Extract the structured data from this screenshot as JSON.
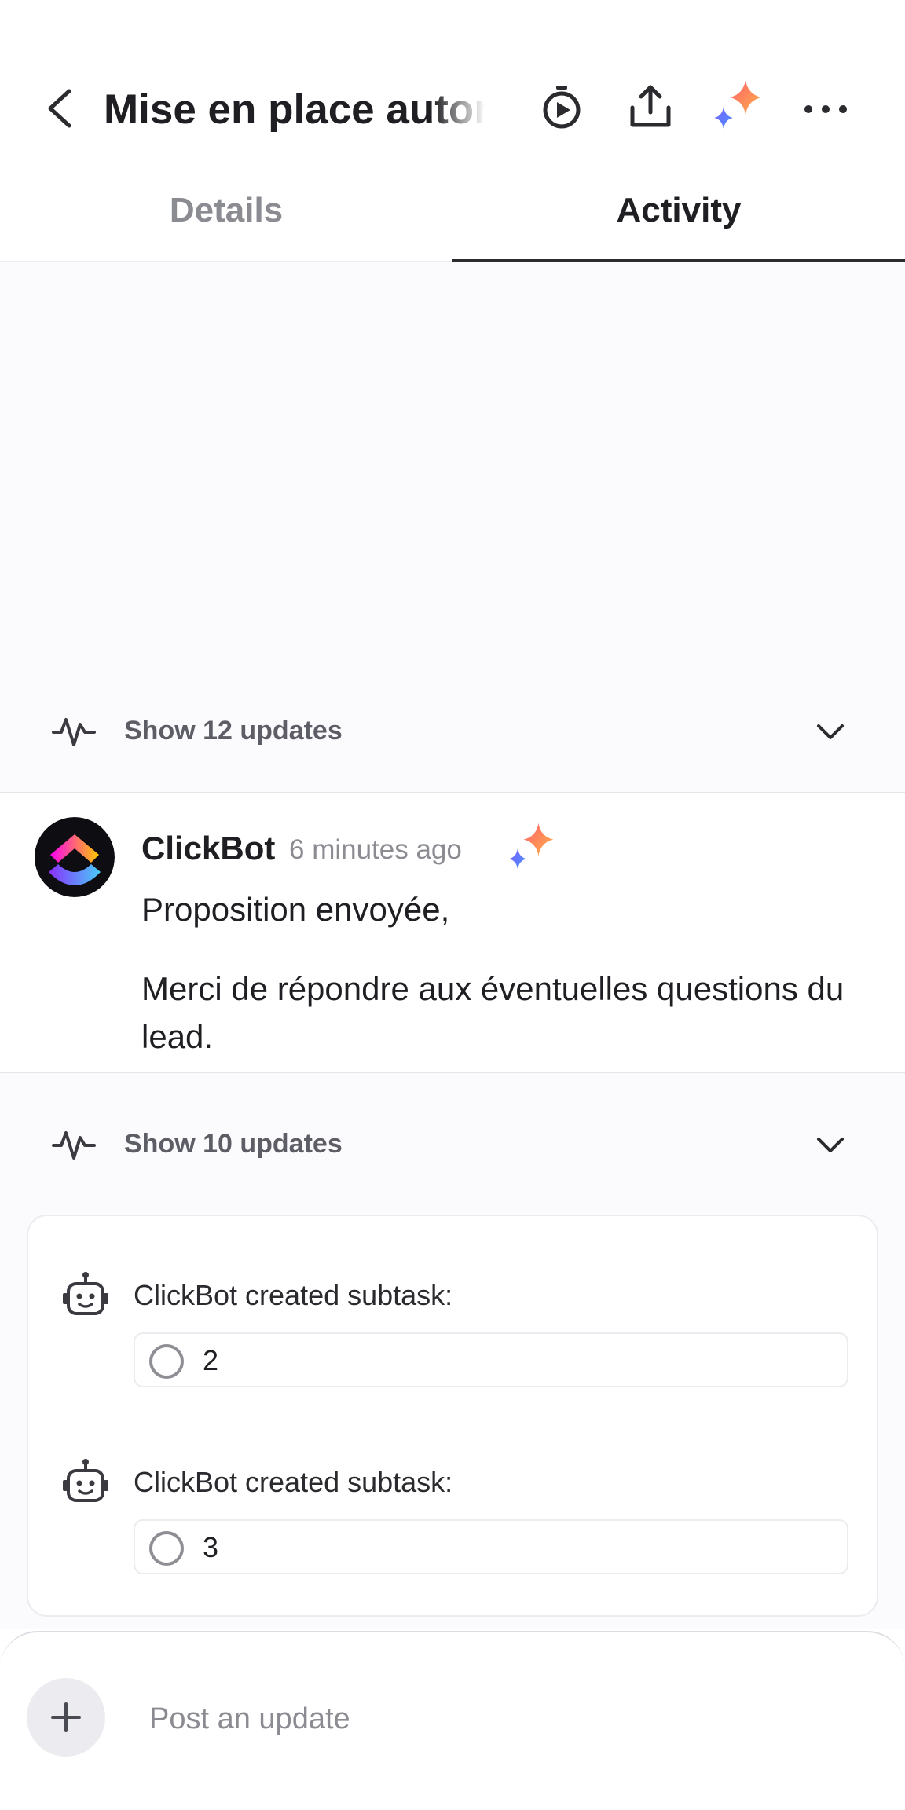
{
  "header": {
    "title": "Mise en place autom",
    "icons": [
      "back-arrow-icon",
      "timer-icon",
      "share-icon",
      "ai-sparkle-icon",
      "more-icon"
    ]
  },
  "tabs": [
    {
      "label": "Details",
      "active": false
    },
    {
      "label": "Activity",
      "active": true
    }
  ],
  "feed": {
    "updates_group_1": {
      "label": "Show 12 updates"
    },
    "comment": {
      "author": "ClickBot",
      "time": "6 minutes ago",
      "lines": [
        "Proposition envoyée,",
        "Merci de répondre aux éventuelles questions du lead."
      ]
    },
    "updates_group_2": {
      "label": "Show 10 updates"
    },
    "subtasks": [
      {
        "label": "ClickBot created subtask:",
        "name": "2"
      },
      {
        "label": "ClickBot created subtask:",
        "name": "3"
      }
    ]
  },
  "composer": {
    "placeholder": "Post an update"
  },
  "colors": {
    "ai_gradient": [
      "#ff5f6d",
      "#ffb347",
      "#7b61ff",
      "#4a90ff"
    ]
  }
}
